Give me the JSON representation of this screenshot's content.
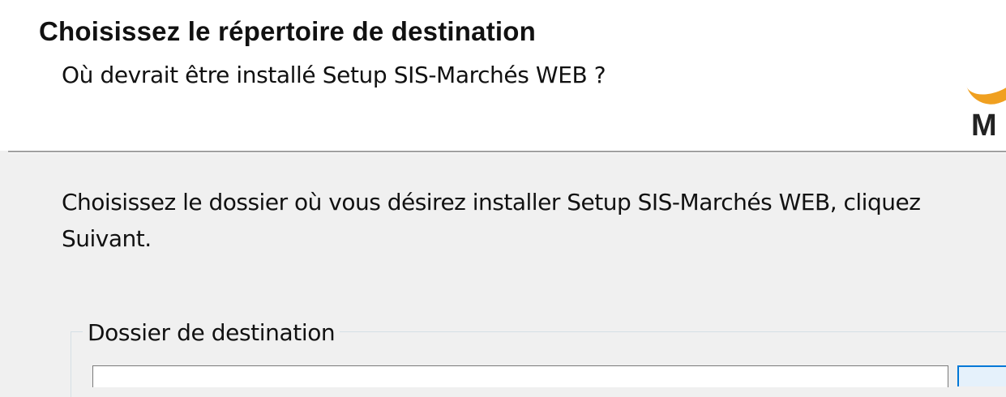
{
  "header": {
    "title": "Choisissez le répertoire de destination",
    "subtitle": "Où devrait être installé Setup SIS-Marchés WEB ?",
    "logo_letter": "M"
  },
  "content": {
    "instruction_line1": "Choisissez le dossier où vous désirez installer Setup SIS-Marchés WEB, cliquez",
    "instruction_line2": "Suivant.",
    "group_label": "Dossier de destination",
    "path_value": ""
  },
  "colors": {
    "header_bg": "#ffffff",
    "body_bg": "#f0f0f0",
    "logo_accent": "#f0a020",
    "button_focus": "#0078d7"
  }
}
